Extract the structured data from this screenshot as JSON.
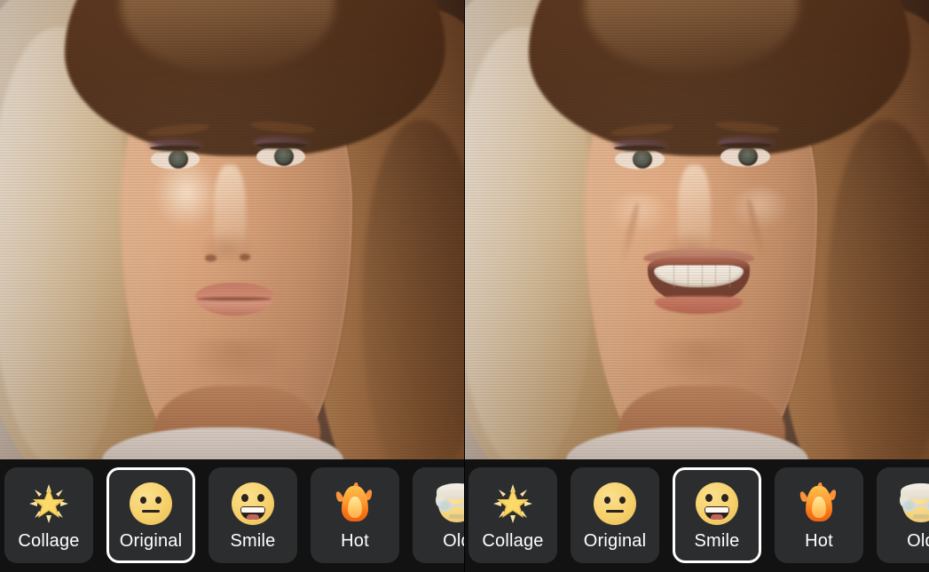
{
  "app": {
    "name": "face-filter-editor",
    "comparison_layout": "side-by-side",
    "colors": {
      "bar_background": "#121212",
      "tile_background": "#2c2d2f",
      "selected_outline": "#ffffff",
      "label_text": "#ffffff",
      "emoji_yellow": "#f6d06b",
      "flame_orange": "#f97316"
    }
  },
  "panels": [
    {
      "id": "left-panel",
      "photo": {
        "subject": "woman portrait",
        "expression": "neutral",
        "alt": "Portrait of a blonde woman with a neutral, unsmiling expression"
      },
      "filter_bar": {
        "selected": "Original",
        "items": [
          {
            "label": "Collage",
            "icon": "glowing-star-icon",
            "selected": false,
            "truncated": false
          },
          {
            "label": "Original",
            "icon": "neutral-face-icon",
            "selected": true,
            "truncated": false
          },
          {
            "label": "Smile",
            "icon": "grinning-face-icon",
            "selected": false,
            "truncated": false
          },
          {
            "label": "Hot",
            "icon": "fire-icon",
            "selected": false,
            "truncated": false
          },
          {
            "label": "Old",
            "icon": "older-person-icon",
            "selected": false,
            "truncated": true
          }
        ]
      }
    },
    {
      "id": "right-panel",
      "photo": {
        "subject": "woman portrait",
        "expression": "smiling",
        "alt": "Same portrait with an AI-generated smiling expression"
      },
      "filter_bar": {
        "selected": "Smile",
        "items": [
          {
            "label": "Collage",
            "icon": "glowing-star-icon",
            "selected": false,
            "truncated": false
          },
          {
            "label": "Original",
            "icon": "neutral-face-icon",
            "selected": false,
            "truncated": false
          },
          {
            "label": "Smile",
            "icon": "grinning-face-icon",
            "selected": true,
            "truncated": false
          },
          {
            "label": "Hot",
            "icon": "fire-icon",
            "selected": false,
            "truncated": false
          },
          {
            "label": "Old",
            "icon": "older-person-icon",
            "selected": false,
            "truncated": true
          }
        ]
      }
    }
  ]
}
